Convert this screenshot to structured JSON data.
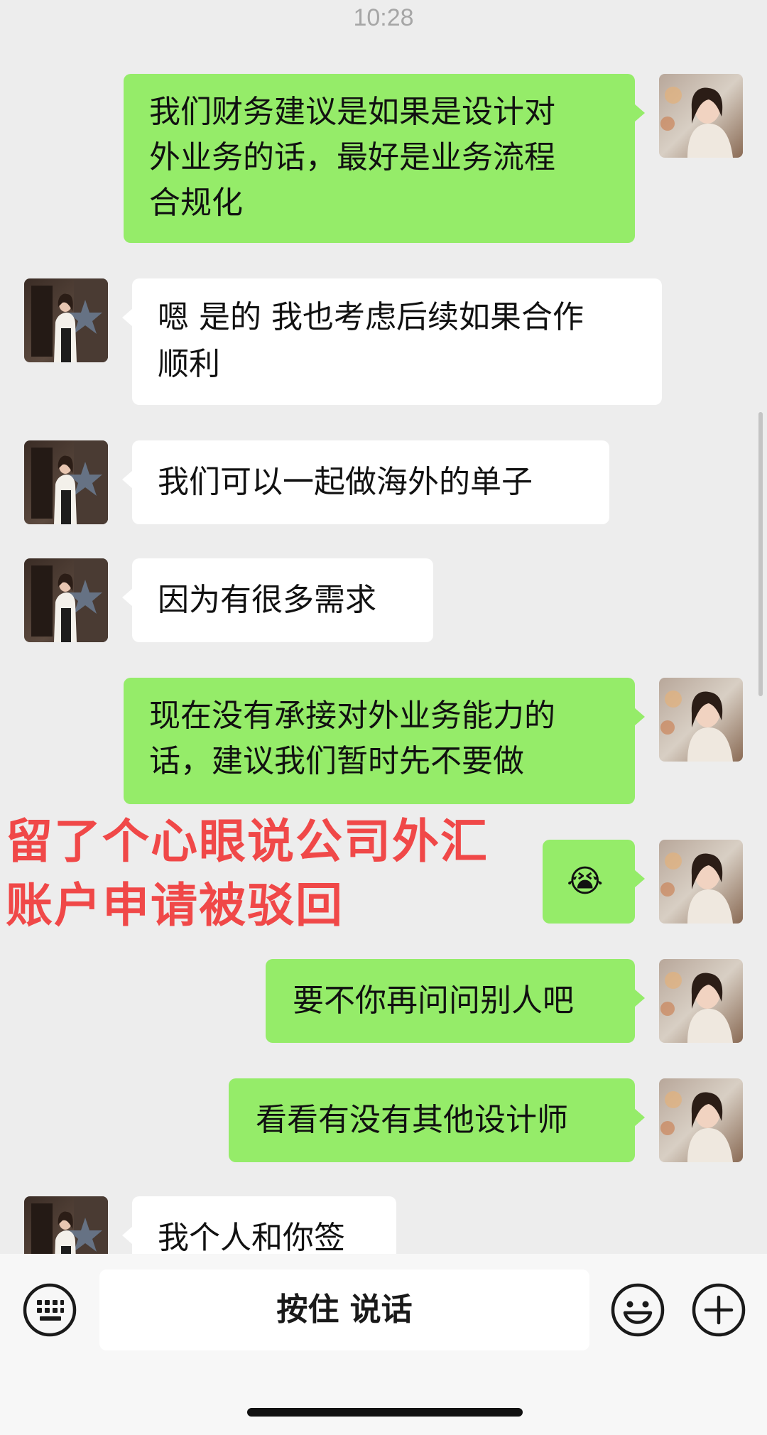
{
  "status": {
    "time": "10:28"
  },
  "messages": [
    {
      "side": "right",
      "text": "我们财务建议是如果是设计对\n外业务的话，最好是业务流程\n合规化"
    },
    {
      "side": "left",
      "text": "嗯 是的 我也考虑后续如果合作\n顺利"
    },
    {
      "side": "left",
      "text": "我们可以一起做海外的单子"
    },
    {
      "side": "left",
      "text": "因为有很多需求"
    },
    {
      "side": "right",
      "text": "现在没有承接对外业务能力的\n话，建议我们暂时先不要做"
    },
    {
      "side": "right",
      "text": "😭"
    },
    {
      "side": "right",
      "text": "要不你再问问别人吧"
    },
    {
      "side": "right",
      "text": "看看有没有其他设计师"
    },
    {
      "side": "left",
      "text": "我个人和你签"
    }
  ],
  "annotation": {
    "text": "留了个心眼说公司外汇\n账户申请被驳回",
    "color": "#f04848"
  },
  "input_bar": {
    "voice_label": "按住 说话",
    "left_icon": "keyboard-icon",
    "emoji_icon": "emoji-icon",
    "plus_icon": "plus-icon"
  },
  "colors": {
    "background": "#ededed",
    "bubble_self": "#95ec69",
    "bubble_other": "#ffffff",
    "annotation": "#f04848"
  }
}
